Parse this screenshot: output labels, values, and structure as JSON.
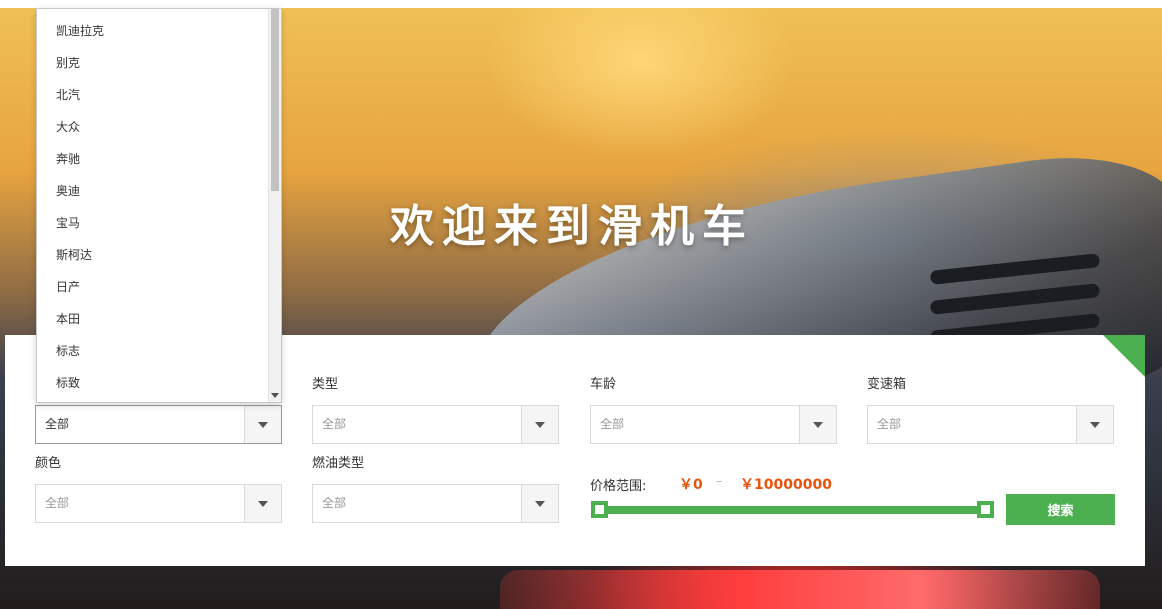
{
  "hero": {
    "title": "欢迎来到滑机车"
  },
  "filters": {
    "brand": {
      "label": "",
      "value": "全部"
    },
    "type": {
      "label": "类型",
      "value": "全部"
    },
    "age": {
      "label": "车龄",
      "value": "全部"
    },
    "transmission": {
      "label": "变速箱",
      "value": "全部"
    },
    "color": {
      "label": "颜色",
      "value": "全部"
    },
    "fuel": {
      "label": "燃油类型",
      "value": "全部"
    }
  },
  "price": {
    "label": "价格范围:",
    "min": "￥0",
    "separator": "–",
    "max": "￥10000000",
    "range_fraction": [
      0,
      1
    ]
  },
  "search_button": {
    "label": "搜索"
  },
  "brand_dropdown": {
    "items": [
      "凯迪拉克",
      "别克",
      "北汽",
      "大众",
      "奔驰",
      "奥迪",
      "宝马",
      "斯柯达",
      "日产",
      "本田",
      "标志",
      "标致"
    ]
  },
  "colors": {
    "accent": "#4caf50",
    "price": "#e8540c"
  },
  "icons": {
    "select_arrow": "chevron-down-icon",
    "scroll_down": "scroll-down-arrow-icon"
  }
}
